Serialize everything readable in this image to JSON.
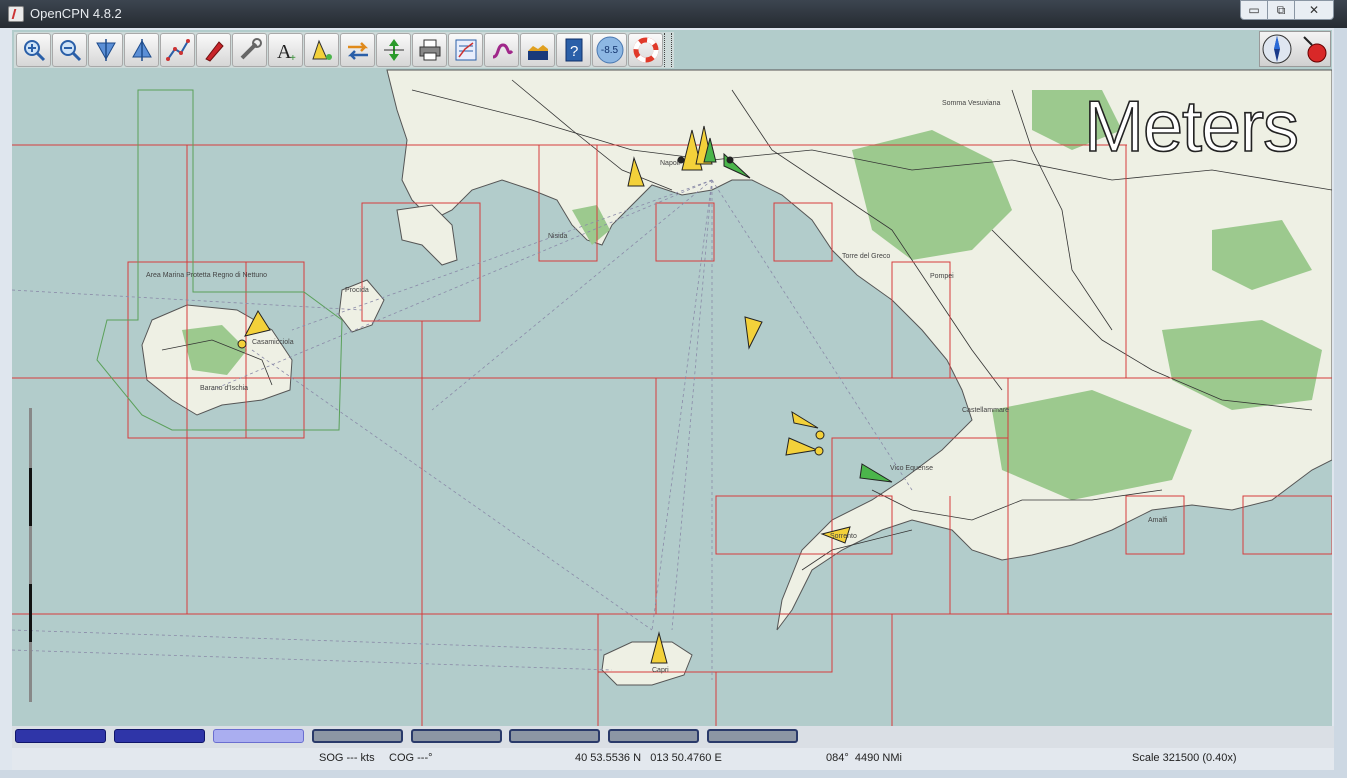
{
  "window": {
    "title": "OpenCPN 4.8.2",
    "min_label": "▭",
    "max_label": "⧉",
    "close_label": "✕"
  },
  "toolbar": {
    "items": [
      {
        "name": "zoom-in-icon",
        "tooltip": ""
      },
      {
        "name": "zoom-out-icon"
      },
      {
        "name": "scale-in-icon"
      },
      {
        "name": "scale-out-icon"
      },
      {
        "name": "route-icon"
      },
      {
        "name": "follow-ship-icon"
      },
      {
        "name": "settings-icon"
      },
      {
        "name": "text-icon"
      },
      {
        "name": "ais-icon"
      },
      {
        "name": "current-icon"
      },
      {
        "name": "tide-icon"
      },
      {
        "name": "print-icon"
      },
      {
        "name": "route-manager-icon"
      },
      {
        "name": "track-icon"
      },
      {
        "name": "color-scheme-icon"
      },
      {
        "name": "help-icon"
      },
      {
        "name": "mob-icon"
      }
    ],
    "zoom_badge": "-8.5"
  },
  "overlay": {
    "depth_unit": "Meters"
  },
  "map": {
    "place_labels": [
      {
        "text": "Area Marina Protetta Regno di Nettuno"
      },
      {
        "text": "Napoli"
      },
      {
        "text": "Procida"
      },
      {
        "text": "Nisida"
      },
      {
        "text": "Capri"
      },
      {
        "text": "Sorrento"
      },
      {
        "text": "Vico Equense"
      },
      {
        "text": "Amalfi"
      },
      {
        "text": "Castellammare"
      },
      {
        "text": "Torre del Greco"
      },
      {
        "text": "Pompei"
      },
      {
        "text": "Barano d'Ischia"
      },
      {
        "text": "Casamicciola"
      },
      {
        "text": "Somma Vesuviana"
      }
    ]
  },
  "colors": {
    "sea": "#b2cccb",
    "land": "#eef0e4",
    "forest": "#9cc98e",
    "quilt": "#d53c3c",
    "ais_yellow": "#f3d13a",
    "ais_green": "#4bb54b",
    "piano_dark": "#2f35a8",
    "piano_light": "#aaaef0"
  },
  "piano": {
    "keys": [
      {
        "state": "active"
      },
      {
        "state": "active"
      },
      {
        "state": "current"
      },
      {
        "state": "inactive"
      },
      {
        "state": "inactive"
      },
      {
        "state": "inactive"
      },
      {
        "state": "inactive"
      },
      {
        "state": "inactive"
      }
    ]
  },
  "status": {
    "sog": "SOG --- kts",
    "cog": "COG ---°",
    "position": "40 53.5536 N   013 50.4760 E",
    "bearing": "084°  4490 NMi",
    "scale": "Scale 321500 (0.40x)"
  }
}
